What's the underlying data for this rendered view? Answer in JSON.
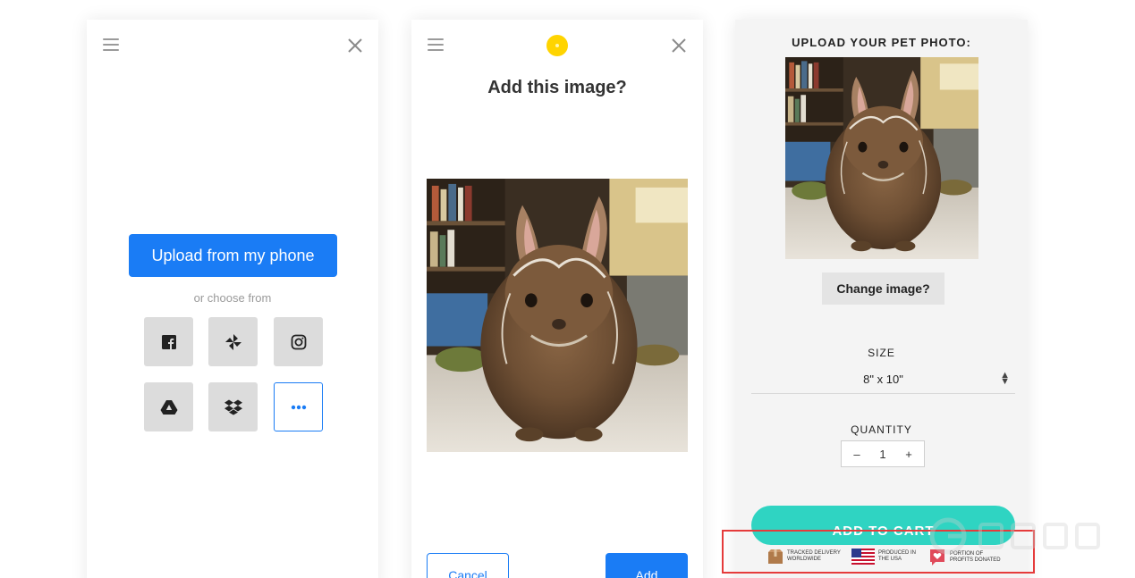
{
  "screen1": {
    "upload_button": "Upload from my phone",
    "choose_text": "or choose from",
    "sources": [
      "facebook-icon",
      "pinwheel-icon",
      "instagram-icon",
      "google-drive-icon",
      "dropbox-icon",
      "more-icon"
    ],
    "accent_color": "#1a7cf5"
  },
  "screen2": {
    "title": "Add this image?",
    "cancel_button": "Cancel",
    "add_button": "Add",
    "logo_color": "#ffd400"
  },
  "screen3": {
    "title": "UPLOAD YOUR PET PHOTO:",
    "change_button": "Change image?",
    "size_label": "SIZE",
    "size_value": "8\" x 10\"",
    "quantity_label": "QUANTITY",
    "quantity_minus": "–",
    "quantity_value": "1",
    "quantity_plus": "+",
    "cart_button": "ADD TO CART",
    "cart_color": "#2fd4c2",
    "badges": [
      {
        "line1": "TRACKED DELIVERY",
        "line2": "WORLDWIDE"
      },
      {
        "line1": "PRODUCED IN",
        "line2": "THE USA"
      },
      {
        "line1": "PORTION OF",
        "line2": "PROFITS DONATED"
      }
    ]
  },
  "annotation": {
    "highlight_color": "#e53b3b"
  }
}
